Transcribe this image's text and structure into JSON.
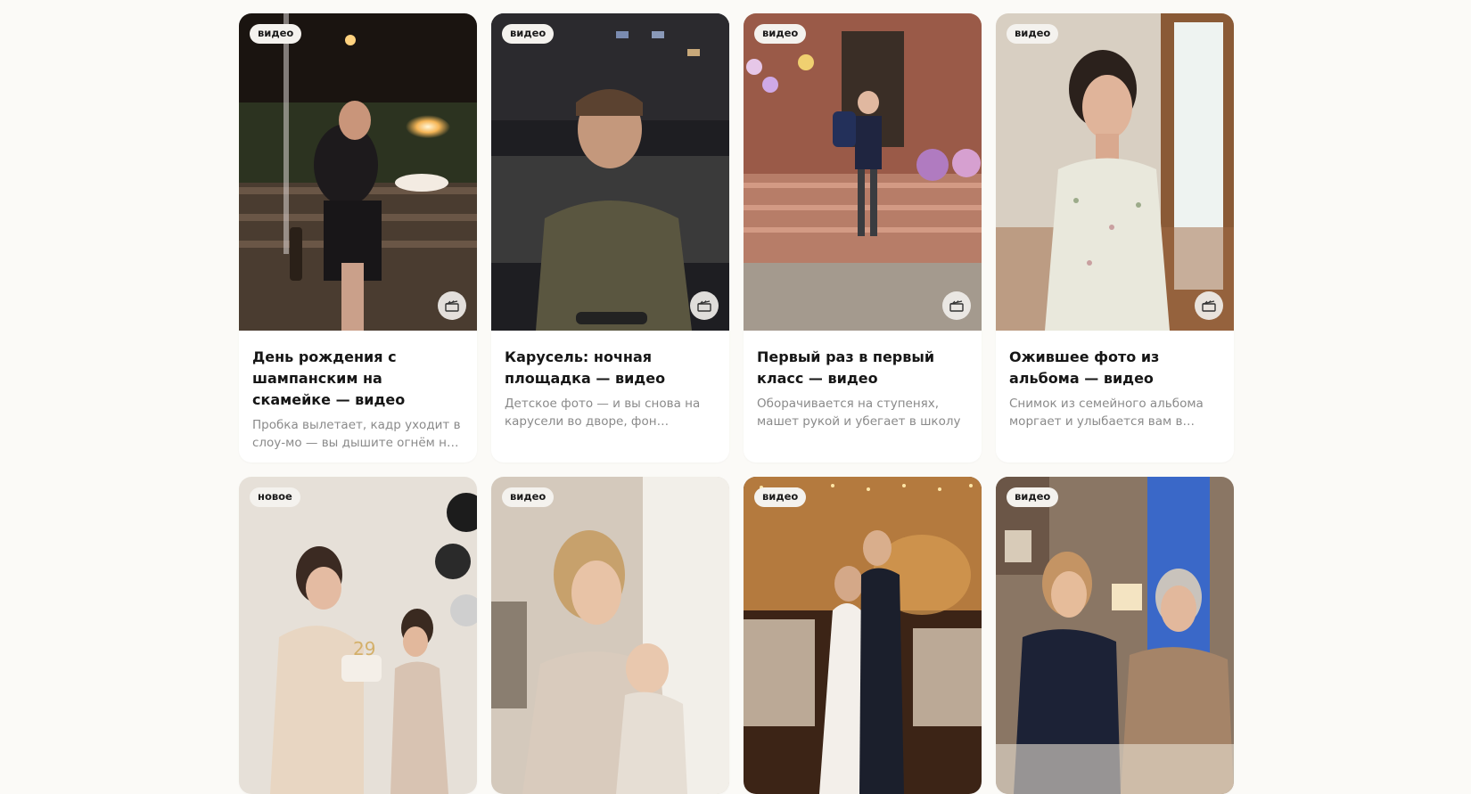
{
  "cards": [
    {
      "badge": "видео",
      "title": "День рождения с шампанским на скамейке — видео",
      "description": "Пробка вылетает, кадр уходит в слоу-мо — вы дышите огнём на торт",
      "icon": "clapperboard-icon"
    },
    {
      "badge": "видео",
      "title": "Карусель: ночная площадка — видео",
      "description": "Детское фото — и вы снова на карусели во дворе, фон срывается в ночь",
      "icon": "clapperboard-icon"
    },
    {
      "badge": "видео",
      "title": "Первый раз в первый класс — видео",
      "description": "Оборачивается на ступенях, машет рукой и убегает в школу",
      "icon": "clapperboard-icon"
    },
    {
      "badge": "видео",
      "title": "Ожившее фото из альбома — видео",
      "description": "Снимок из семейного альбома моргает и улыбается вам в камеру",
      "icon": "clapperboard-icon"
    },
    {
      "badge": "новое"
    },
    {
      "badge": "видео"
    },
    {
      "badge": "видео"
    },
    {
      "badge": "видео"
    }
  ],
  "colors": {
    "page_bg": "#fbfaf7",
    "card_bg": "#ffffff",
    "badge_bg": "#f4f2ee",
    "title_text": "#161616",
    "desc_text": "#8a8a8a"
  }
}
